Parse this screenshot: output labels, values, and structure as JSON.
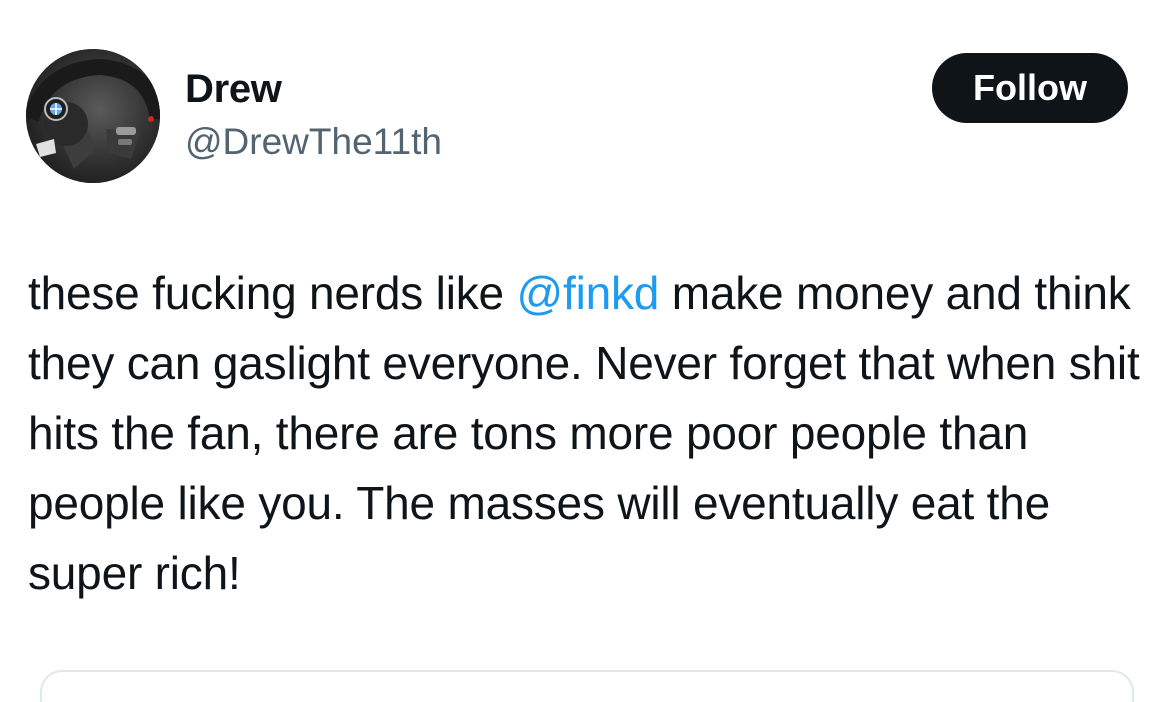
{
  "user": {
    "display_name": "Drew",
    "handle": "@DrewThe11th"
  },
  "follow_button": {
    "label": "Follow"
  },
  "tweet": {
    "text_before": "these fucking nerds like ",
    "mention": "@finkd",
    "text_after": " make money and think they can gaslight everyone. Never forget that when shit hits the fan, there are tons more poor people than people like you. The masses will eventually eat the super rich!"
  },
  "icons": {
    "avatar": "steering-wheel-photo"
  },
  "colors": {
    "text": "#0f1419",
    "handle": "#536471",
    "mention": "#1d9bf0",
    "button_bg": "#0f1419",
    "button_text": "#ffffff"
  }
}
